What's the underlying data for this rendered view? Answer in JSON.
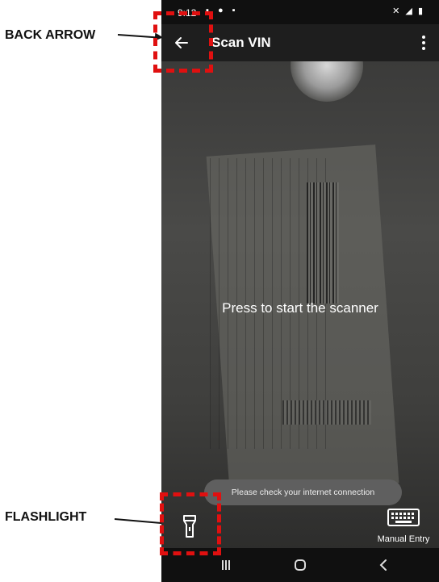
{
  "callouts": {
    "back_arrow": "BACK ARROW",
    "flashlight": "FLASHLIGHT"
  },
  "status_bar": {
    "time": "9:12"
  },
  "app_bar": {
    "title": "Scan VIN",
    "back_icon": "arrow-left-icon",
    "menu_icon": "more-vert-icon"
  },
  "scanner": {
    "prompt": "Press to start the scanner"
  },
  "toast": {
    "message": "Please check your internet connection"
  },
  "bottom_controls": {
    "flashlight_icon": "flashlight-icon",
    "manual_entry_label": "Manual Entry",
    "manual_entry_icon": "keyboard-icon"
  },
  "nav_bar": {
    "icons": [
      "recents-icon",
      "home-icon",
      "back-icon"
    ]
  },
  "colors": {
    "highlight": "#e01010",
    "app_bar": "#1e1e1e",
    "toast": "#5f5f5f"
  }
}
